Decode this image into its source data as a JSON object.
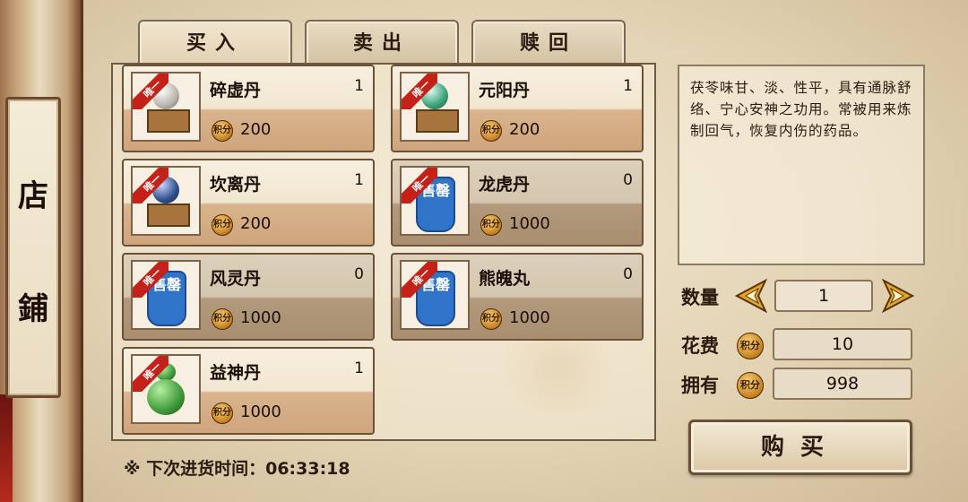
{
  "side_title": [
    "店",
    "鋪"
  ],
  "tabs": [
    {
      "label": "买入",
      "active": true
    },
    {
      "label": "卖出",
      "active": false
    },
    {
      "label": "赎回",
      "active": false
    }
  ],
  "ribbon_text": "唯一",
  "coin_label": "积分",
  "sold_out_text": "售罄",
  "items": [
    {
      "name": "碎虚丹",
      "qty": "1",
      "price": "200",
      "sold_out": false,
      "orb": "#b9b5ad"
    },
    {
      "name": "元阳丹",
      "qty": "1",
      "price": "200",
      "sold_out": false,
      "orb": "#3aa07a"
    },
    {
      "name": "坎离丹",
      "qty": "1",
      "price": "200",
      "sold_out": false,
      "orb": "#2d4f8c"
    },
    {
      "name": "龙虎丹",
      "qty": "0",
      "price": "1000",
      "sold_out": true
    },
    {
      "name": "风灵丹",
      "qty": "0",
      "price": "1000",
      "sold_out": true
    },
    {
      "name": "熊魄丸",
      "qty": "0",
      "price": "1000",
      "sold_out": true
    },
    {
      "name": "益神丹",
      "qty": "1",
      "price": "1000",
      "sold_out": false,
      "gourd": "#3f9a3a"
    }
  ],
  "refresh": {
    "label": "※ 下次进货时间：",
    "time": "06:33:18"
  },
  "description": "茯苓味甘、淡、性平，具有通脉舒络、宁心安神之功用。常被用来炼制回气，恢复内伤的药品。",
  "quantity": {
    "label": "数量",
    "value": "1"
  },
  "cost": {
    "label": "花费",
    "value": "10"
  },
  "owned": {
    "label": "拥有",
    "value": "998"
  },
  "buy_button": "购买"
}
